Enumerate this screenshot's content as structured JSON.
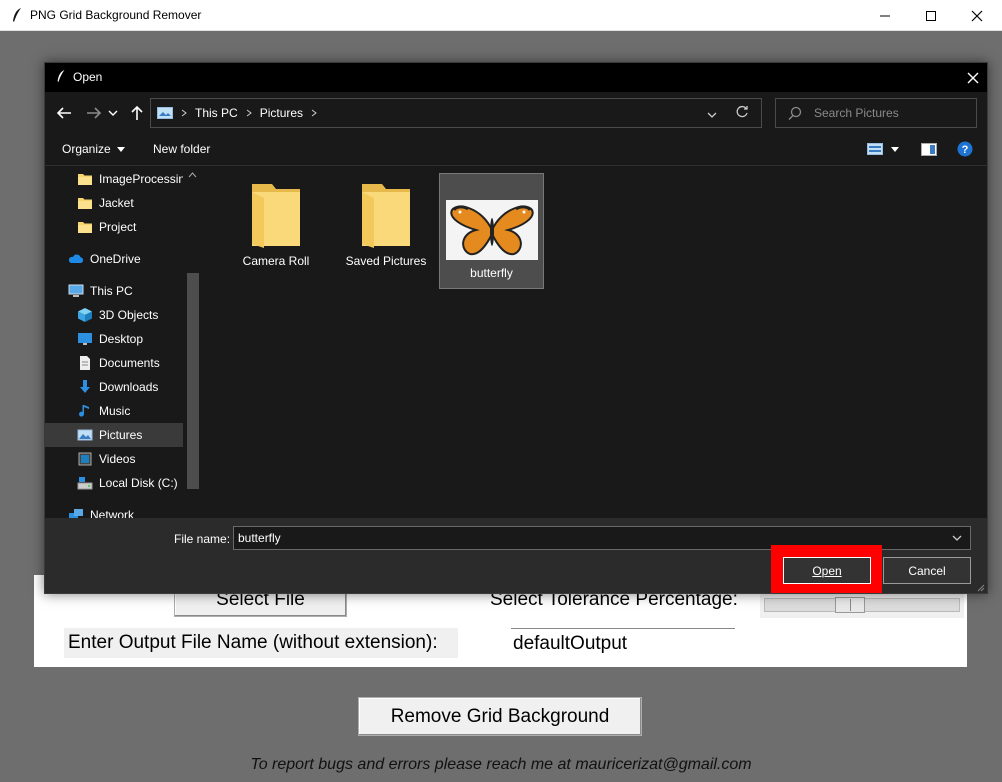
{
  "app": {
    "title": "PNG Grid Background Remover",
    "select_file_button": "Select File",
    "tolerance_label": "Select Tolerance Percentage:",
    "tolerance_value_percent": 43,
    "output_label": "Enter Output File Name (without extension):",
    "output_value": "defaultOutput",
    "remove_button": "Remove Grid Background",
    "footer_text": "To report bugs and errors please reach me at mauricerizat@gmail.com"
  },
  "dialog": {
    "title": "Open",
    "breadcrumb": [
      "This PC",
      "Pictures"
    ],
    "search_placeholder": "Search Pictures",
    "toolbar": {
      "organize": "Organize",
      "new_folder": "New folder"
    },
    "nav_items": [
      {
        "label": "ImageProcessing",
        "icon": "folder-icon"
      },
      {
        "label": "Jacket",
        "icon": "folder-icon"
      },
      {
        "label": "Project",
        "icon": "folder-icon"
      },
      {
        "label": "OneDrive",
        "icon": "cloud-icon"
      },
      {
        "label": "This PC",
        "icon": "computer-icon"
      },
      {
        "label": "3D Objects",
        "icon": "cube-icon"
      },
      {
        "label": "Desktop",
        "icon": "desktop-icon"
      },
      {
        "label": "Documents",
        "icon": "document-icon"
      },
      {
        "label": "Downloads",
        "icon": "download-icon"
      },
      {
        "label": "Music",
        "icon": "music-icon"
      },
      {
        "label": "Pictures",
        "icon": "pictures-icon"
      },
      {
        "label": "Videos",
        "icon": "video-icon"
      },
      {
        "label": "Local Disk (C:)",
        "icon": "disk-icon"
      },
      {
        "label": "Network",
        "icon": "network-icon"
      }
    ],
    "files": [
      {
        "label": "Camera Roll",
        "type": "folder"
      },
      {
        "label": "Saved Pictures",
        "type": "folder"
      },
      {
        "label": "butterfly",
        "type": "image"
      }
    ],
    "file_name_label": "File name:",
    "file_name_value": "butterfly",
    "open_button": "Open",
    "cancel_button": "Cancel"
  }
}
